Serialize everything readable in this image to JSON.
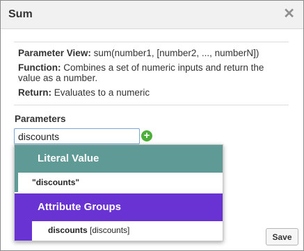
{
  "dialog": {
    "title": "Sum",
    "close_glyph": "✕"
  },
  "info": {
    "parameter_view_label": "Parameter View:",
    "parameter_view_value": "sum(number1, [number2, ..., numberN])",
    "function_label": "Function:",
    "function_value_line1": "Combines a set of numeric inputs and return the",
    "function_value_line2": "value as a number.",
    "return_label": "Return:",
    "return_value": "Evaluates to a numeric"
  },
  "parameters": {
    "label": "Parameters",
    "input_value": "discounts",
    "add_icon": "+"
  },
  "dropdown": {
    "literal_group_label": "Literal Value",
    "literal_option": "\"discounts\"",
    "attribute_group_label": "Attribute Groups",
    "attribute_option_name": "discounts",
    "attribute_option_group": "[discounts]"
  },
  "footer": {
    "save_label": "Save"
  },
  "colors": {
    "literal_header": "#5f9a97",
    "attribute_header": "#6933d3",
    "input_border": "#7aa4d6",
    "add_icon": "#4caf3a"
  }
}
